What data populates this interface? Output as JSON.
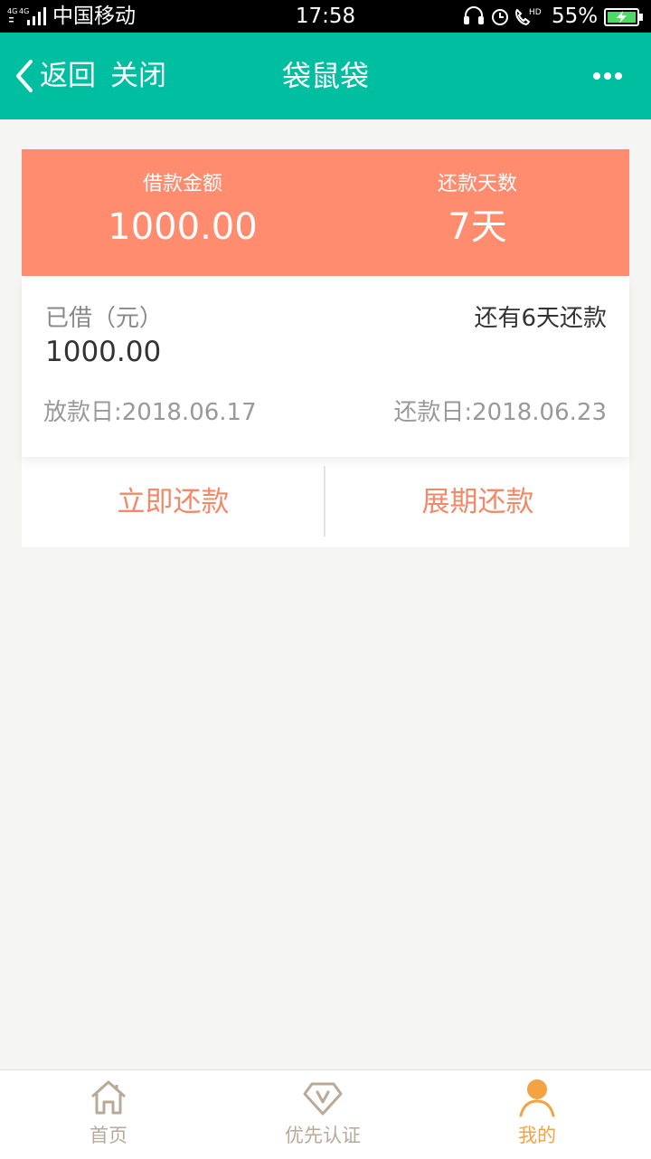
{
  "status_bar": {
    "network": "4G 4G",
    "carrier": "中国移动",
    "time": "17:58",
    "battery": "55%"
  },
  "nav": {
    "back_label": "返回",
    "close_label": "关闭",
    "title": "袋鼠袋"
  },
  "loan_summary": {
    "amount_label": "借款金额",
    "amount_value": "1000.00",
    "days_label": "还款天数",
    "days_value": "7天"
  },
  "loan_detail": {
    "borrowed_label": "已借（元）",
    "borrowed_amount": "1000.00",
    "remaining_text": "还有6天还款",
    "loan_date": "放款日:2018.06.17",
    "repay_date": "还款日:2018.06.23"
  },
  "actions": {
    "repay_now": "立即还款",
    "extend_repay": "展期还款"
  },
  "tabs": [
    {
      "label": "首页",
      "icon": "home-icon",
      "active": false
    },
    {
      "label": "优先认证",
      "icon": "v-badge-icon",
      "active": false
    },
    {
      "label": "我的",
      "icon": "user-icon",
      "active": true
    }
  ],
  "colors": {
    "nav_bg": "#00bfa0",
    "card_header_bg": "#ff8c6e",
    "action_text": "#f28a6a",
    "tab_active": "#f3a343",
    "tab_inactive": "#b9aa98"
  }
}
